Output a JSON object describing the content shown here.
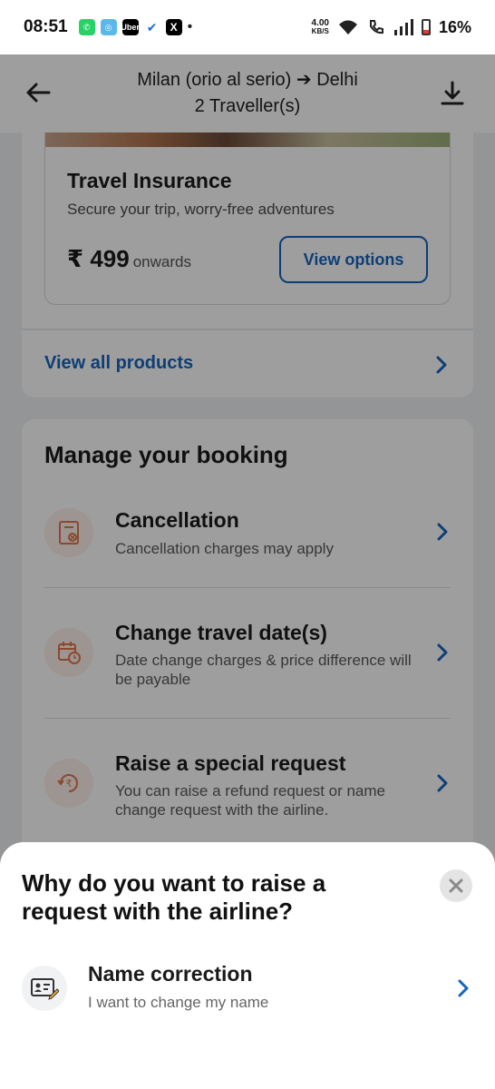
{
  "status_bar": {
    "time": "08:51",
    "apps": [
      "whatsapp-icon",
      "signal-icon",
      "uber-icon",
      "check-icon",
      "x-icon"
    ],
    "app_labels": {
      "uber": "Uber",
      "x": "X"
    },
    "network_speed_value": "4.00",
    "network_speed_unit": "KB/S",
    "battery": "16%"
  },
  "header": {
    "origin": "Milan (orio al serio)",
    "arrow": "➔",
    "destination": "Delhi",
    "travellers": "2 Traveller(s)"
  },
  "insurance": {
    "title": "Travel Insurance",
    "subtitle": "Secure your trip, worry-free adventures",
    "price": "₹ 499",
    "price_suffix": "onwards",
    "button": "View options",
    "view_all": "View all products"
  },
  "manage": {
    "heading": "Manage your booking",
    "items": [
      {
        "title": "Cancellation",
        "desc": "Cancellation charges may apply"
      },
      {
        "title": "Change travel date(s)",
        "desc": "Date change charges & price difference will be payable"
      },
      {
        "title": "Raise a special request",
        "desc": "You can raise a refund request or name change request with the airline."
      }
    ]
  },
  "sheet": {
    "title": "Why do you want to raise a request with the airline?",
    "option": {
      "title": "Name correction",
      "subtitle": "I want to change my name"
    }
  },
  "colors": {
    "accent_blue": "#1565c0",
    "icon_orange": "#e0774b",
    "overlay": "rgba(0,0,0,0.38)"
  }
}
